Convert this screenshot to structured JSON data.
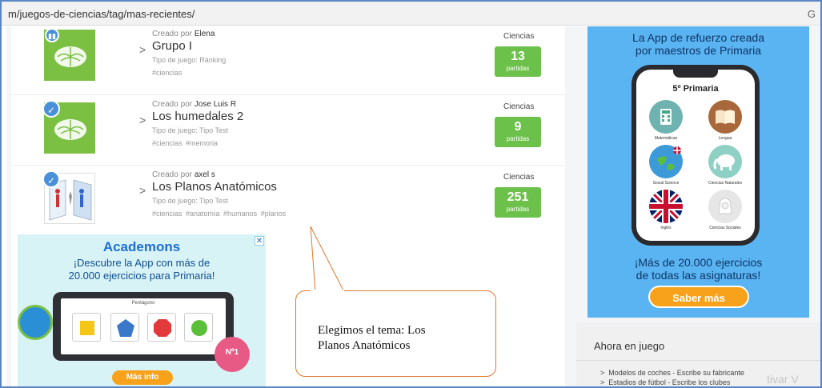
{
  "browser": {
    "url": "m/juegos-de-ciencias/tag/mas-recientes/",
    "right_glyph": "G"
  },
  "games": [
    {
      "created_label": "Creado por",
      "author": "Elena",
      "title": "Grupo I",
      "type": "Tipo de juego: Ránking",
      "tags": "#ciencias",
      "category": "Ciencias",
      "count": "13",
      "count_label": "partidas"
    },
    {
      "created_label": "Creado por",
      "author": "Jose Luis R",
      "title": "Los humedales 2",
      "type": "Tipo de juego: Tipo Test",
      "tags": "#ciencias  #memoria",
      "category": "Ciencias",
      "count": "9",
      "count_label": "partidas"
    },
    {
      "created_label": "Creado por",
      "author": "axel s",
      "title": "Los Planos Anatómicos",
      "type": "Tipo de juego: Tipo Test",
      "tags": "#ciencias  #anatomía  #humanos  #planos",
      "category": "Ciencias",
      "count": "251",
      "count_label": "partidas"
    }
  ],
  "ad_left": {
    "logo": "Academons",
    "text_line1": "¡Descubre la App con más de",
    "text_line2": "20.000 ejercicios para Primaria!",
    "tablet_label": "Pentágono",
    "award_text": "Nº1",
    "button": "Más info",
    "close": "✕",
    "colors": {
      "bg": "#d8f3f6",
      "brand": "#1b6fd8",
      "button": "#f7a21a"
    }
  },
  "ad_right": {
    "title_line1": "La App de refuerzo creada",
    "title_line2": "por maestros de Primaria",
    "grade": "5º Primaria",
    "subjects": [
      "Matemáticas",
      "Lengua",
      "Social Science",
      "Ciencias Naturales",
      "Inglés",
      "Ciencias Sociales"
    ],
    "bottom_line1": "¡Más de 20.000 ejercicios",
    "bottom_line2": "de todas las asignaturas!",
    "button": "Saber más",
    "colors": {
      "bg": "#5ab4f2",
      "button": "#f7a21a"
    }
  },
  "now_playing": {
    "title": "Ahora en juego",
    "items": [
      "Modelos de coches - Escribe su fabricante",
      "Estadios de fútbol - Escribe los clubes"
    ],
    "watermark": "tivar V"
  },
  "callout": {
    "line1": "Elegimos el tema: Los",
    "line2": "Planos Anatómicos"
  },
  "colors": {
    "badge": "#6cc14a",
    "check": "#4a90d9",
    "callout_border": "#e0782f"
  }
}
